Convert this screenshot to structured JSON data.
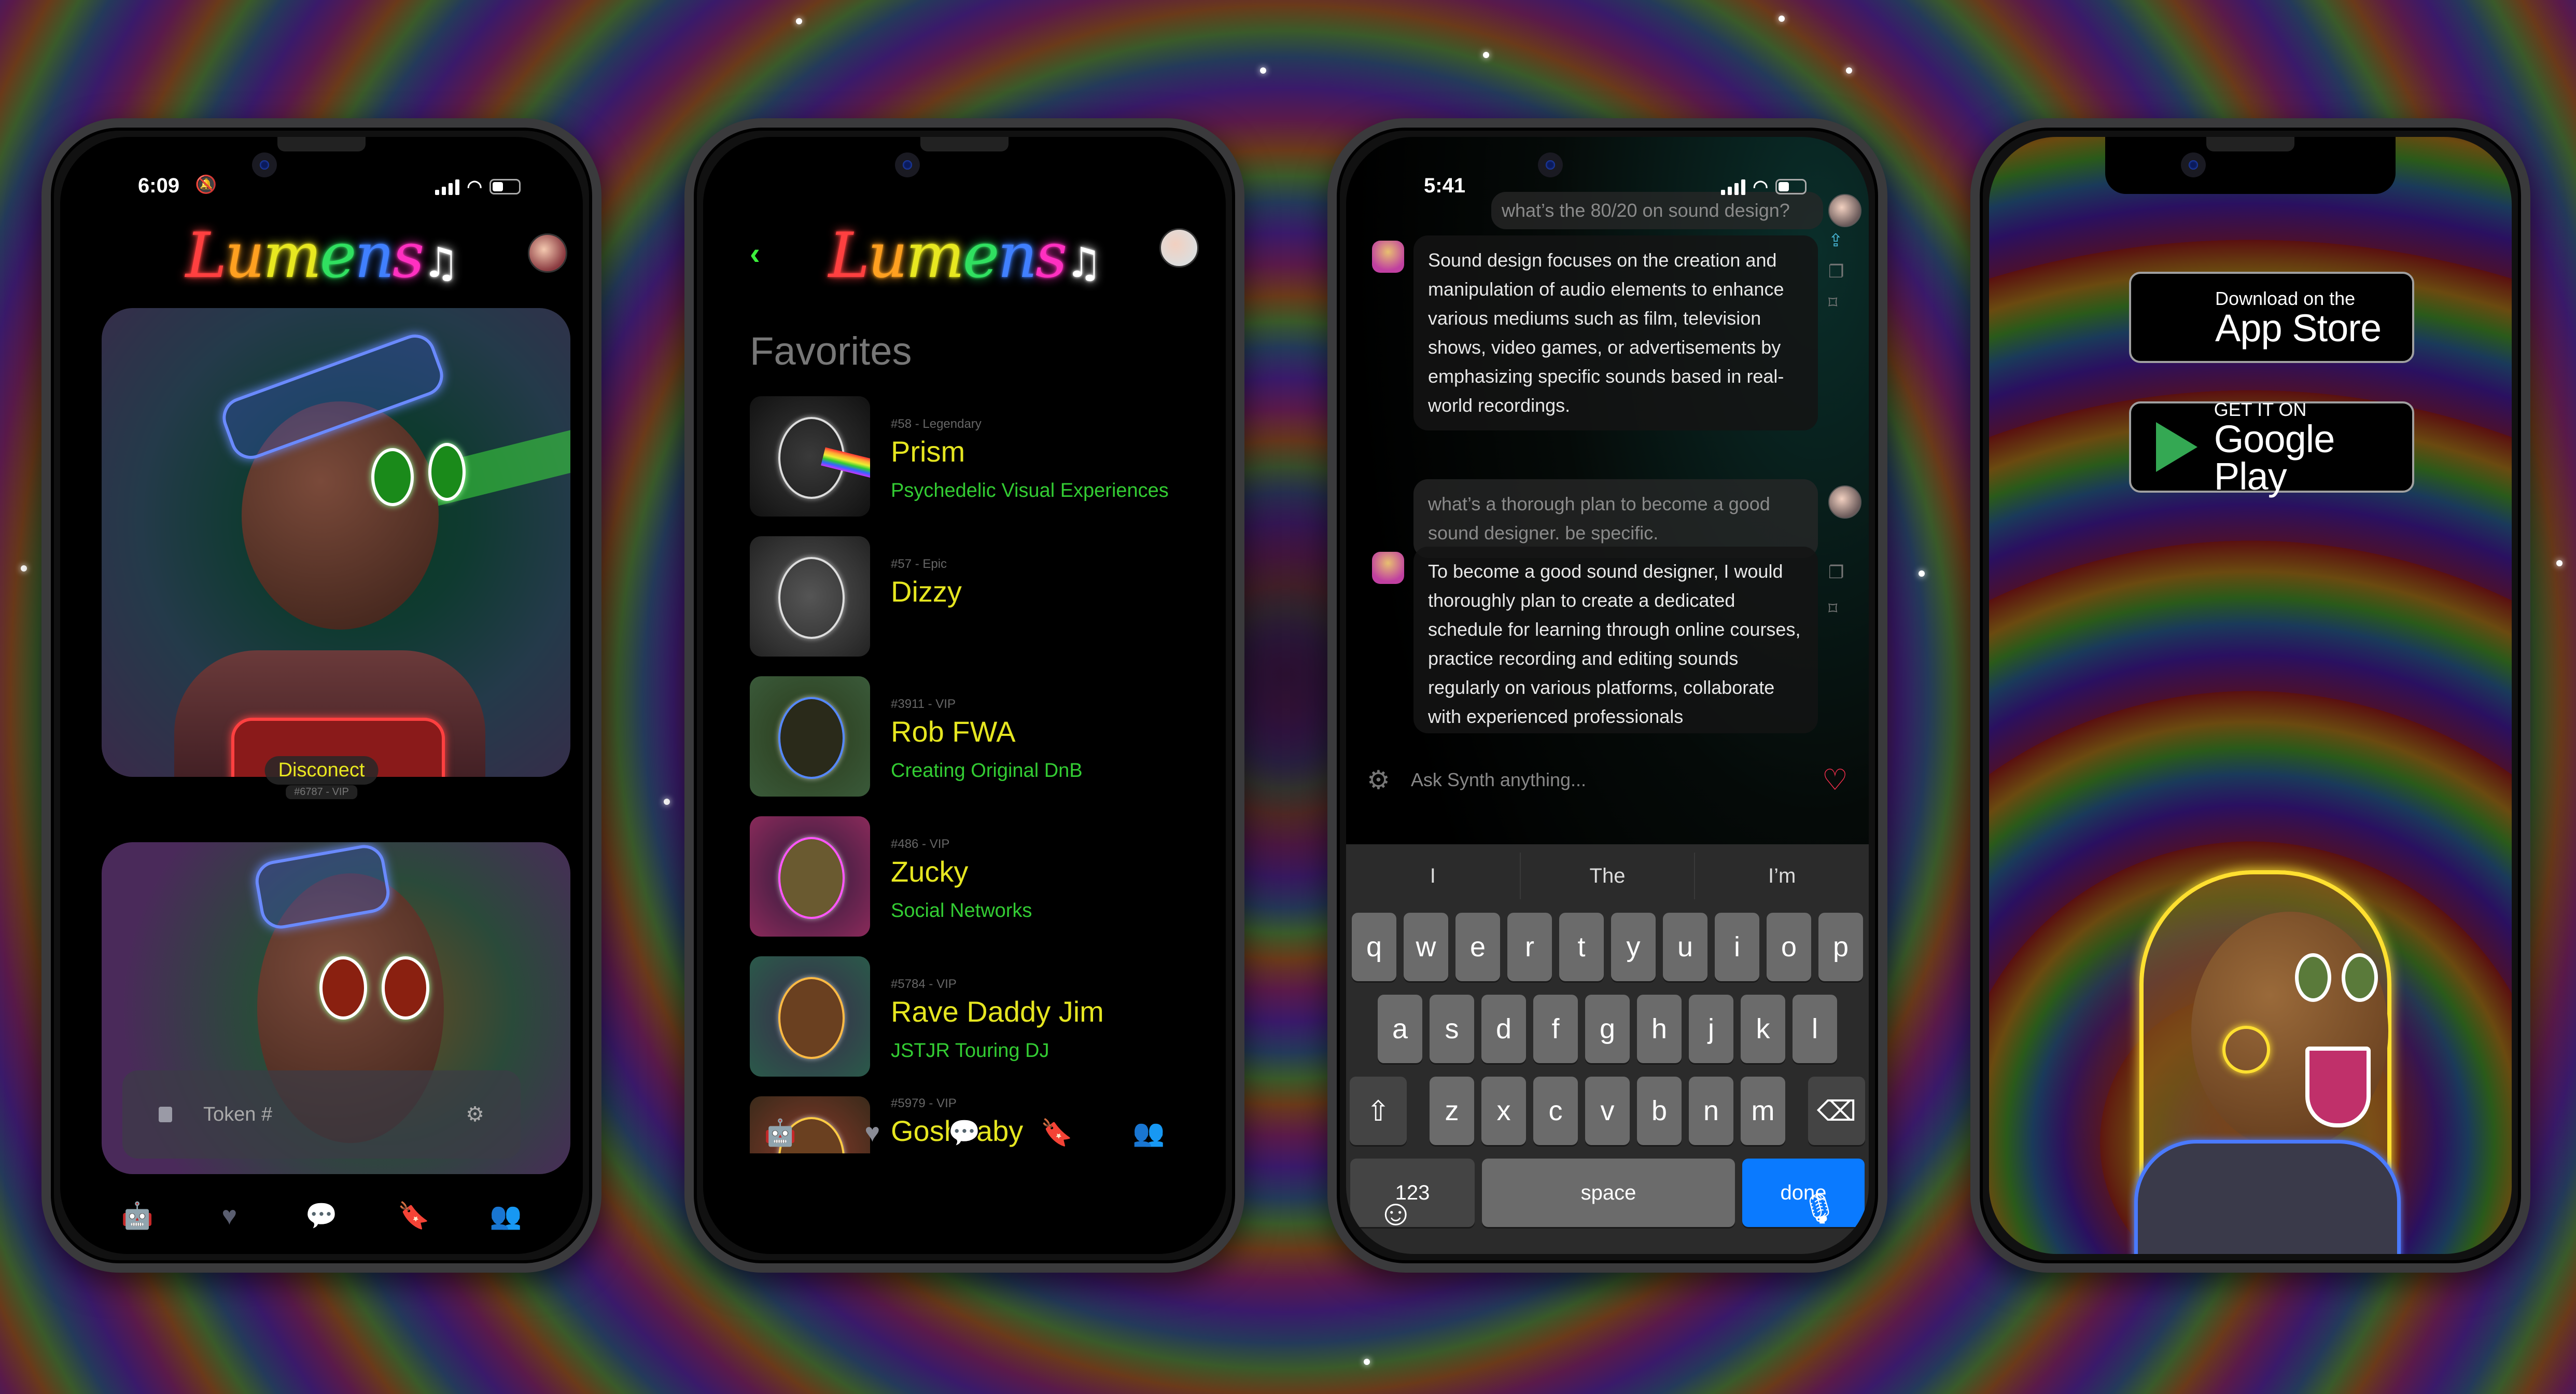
{
  "app": {
    "name": "Lumens",
    "logo_letters": [
      "L",
      "u",
      "m",
      "e",
      "n",
      "s"
    ],
    "logo_colors": [
      "#ff4040",
      "#ffa020",
      "#e8e820",
      "#30e060",
      "#4080ff",
      "#ff30c0"
    ],
    "logo_note": "♫"
  },
  "colors": {
    "accent_yellow": "#e6e620",
    "accent_green": "#33cc33",
    "heart_red": "#ff3050",
    "done_blue": "#0a7aff",
    "tab_icon": "#5a5e70"
  },
  "phone1": {
    "status": {
      "time": "6:09",
      "silent_icon": "bell-slash-icon"
    },
    "card_button": "Disconect",
    "card_sub": "#6787 - VIP",
    "search": {
      "placeholder": "Token #"
    },
    "tabs": [
      {
        "icon": "robot-icon",
        "glyph": "🤖"
      },
      {
        "icon": "heart-icon",
        "glyph": "♥"
      },
      {
        "icon": "chat-icon",
        "glyph": "💬"
      },
      {
        "icon": "bookmark-icon",
        "glyph": "🔖"
      },
      {
        "icon": "community-icon",
        "glyph": "👥"
      }
    ]
  },
  "phone2": {
    "back_icon": "‹",
    "title": "Favorites",
    "items": [
      {
        "meta": "#58 - Legendary",
        "name": "Prism",
        "desc": "Psychedelic Visual Experiences",
        "thumb": "#222"
      },
      {
        "meta": "#57 - Epic",
        "name": "Dizzy",
        "desc": "",
        "thumb": "#333"
      },
      {
        "meta": "#3911 - VIP",
        "name": "Rob FWA",
        "desc": "Creating Original DnB",
        "thumb": "#2a4a2a"
      },
      {
        "meta": "#486 - VIP",
        "name": "Zucky",
        "desc": "Social Networks",
        "thumb": "#5a2a4a"
      },
      {
        "meta": "#5784 - VIP",
        "name": "Rave Daddy Jim",
        "desc": "JSTJR Touring DJ",
        "thumb": "#3a3a5a"
      },
      {
        "meta": "#5979 - VIP",
        "name": "Goshbaby",
        "desc": "",
        "thumb": "#5a3a2a"
      }
    ]
  },
  "phone3": {
    "status": {
      "time": "5:41"
    },
    "messages": [
      {
        "role": "user",
        "text": "what’s the 80/20 on sound design?"
      },
      {
        "role": "bot",
        "text": "Sound design focuses on the creation and manipulation of audio elements to enhance various mediums such as film, television shows, video games, or advertisements by emphasizing specific sounds based in real-world recordings."
      },
      {
        "role": "user",
        "text": "what’s a thorough plan to become a good sound designer. be specific."
      },
      {
        "role": "bot",
        "text": "To become a good sound designer, I would thoroughly plan to create a dedicated schedule for learning through online courses, practice recording and editing sounds regularly on various platforms, collaborate with experienced professionals"
      }
    ],
    "input": {
      "placeholder": "Ask Synth anything..."
    },
    "keyboard": {
      "suggestions": [
        "I",
        "The",
        "I’m"
      ],
      "row1": [
        "q",
        "w",
        "e",
        "r",
        "t",
        "y",
        "u",
        "i",
        "o",
        "p"
      ],
      "row2": [
        "a",
        "s",
        "d",
        "f",
        "g",
        "h",
        "j",
        "k",
        "l"
      ],
      "row3": [
        "z",
        "x",
        "c",
        "v",
        "b",
        "n",
        "m"
      ],
      "shift": "⇧",
      "backspace": "⌫",
      "num": "123",
      "space": "space",
      "done": "done",
      "emoji": "☺",
      "mic": "🎙"
    }
  },
  "phone4": {
    "appstore": {
      "small": "Download on the",
      "big": "App Store"
    },
    "googleplay": {
      "small": "GET IT ON",
      "big": "Google Play"
    }
  }
}
